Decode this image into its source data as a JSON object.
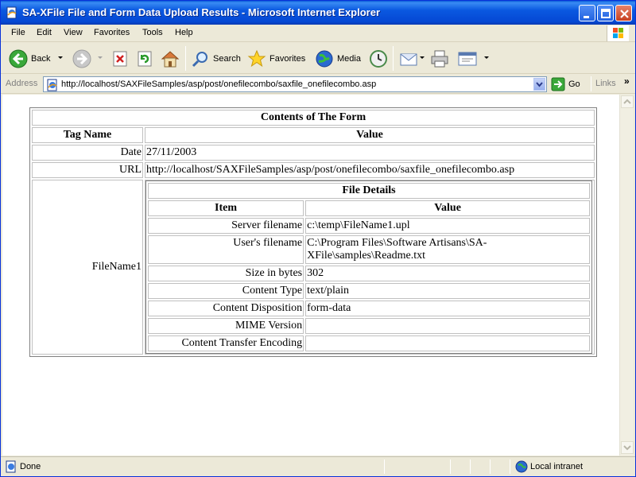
{
  "window": {
    "title": "SA-XFile File and Form Data Upload Results - Microsoft Internet Explorer"
  },
  "menu": {
    "items": [
      "File",
      "Edit",
      "View",
      "Favorites",
      "Tools",
      "Help"
    ]
  },
  "toolbar": {
    "back_label": "Back",
    "search_label": "Search",
    "favorites_label": "Favorites",
    "media_label": "Media"
  },
  "address": {
    "label": "Address",
    "url": "http://localhost/SAXFileSamples/asp/post/onefilecombo/saxfile_onefilecombo.asp",
    "go_label": "Go",
    "links_label": "Links"
  },
  "status": {
    "text": "Done",
    "zone": "Local intranet"
  },
  "form": {
    "caption": "Contents of The Form",
    "col_tag": "Tag Name",
    "col_value": "Value",
    "rows": [
      {
        "tag": "Date",
        "value": "27/11/2003"
      },
      {
        "tag": "URL",
        "value": "http://localhost/SAXFileSamples/asp/post/onefilecombo/saxfile_onefilecombo.asp"
      }
    ],
    "file_tag": "FileName1"
  },
  "file": {
    "caption": "File Details",
    "col_item": "Item",
    "col_value": "Value",
    "rows": [
      {
        "item": "Server filename",
        "value": "c:\\temp\\FileName1.upl"
      },
      {
        "item": "User's filename",
        "value": "C:\\Program Files\\Software Artisans\\SA-XFile\\samples\\Readme.txt"
      },
      {
        "item": "Size in bytes",
        "value": "302"
      },
      {
        "item": "Content Type",
        "value": "text/plain"
      },
      {
        "item": "Content Disposition",
        "value": "form-data"
      },
      {
        "item": "MIME Version",
        "value": ""
      },
      {
        "item": "Content Transfer Encoding",
        "value": ""
      }
    ]
  }
}
